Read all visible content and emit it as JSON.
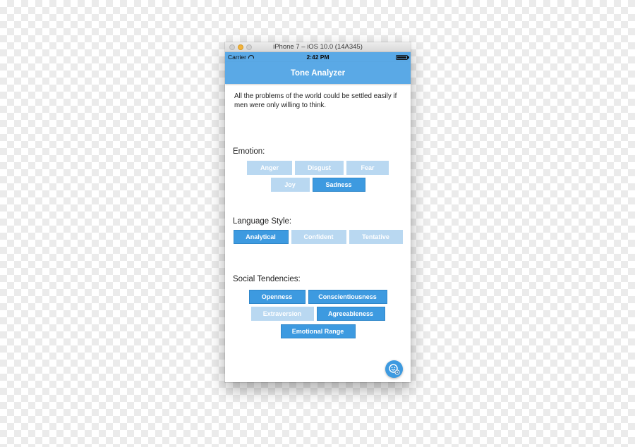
{
  "window": {
    "title": "iPhone 7 – iOS 10.0 (14A345)"
  },
  "statusbar": {
    "carrier": "Carrier",
    "time": "2:42 PM"
  },
  "navbar": {
    "title": "Tone Analyzer"
  },
  "quote": {
    "text": "All the problems of the world could be settled easily if men were only willing to think."
  },
  "emotion": {
    "label": "Emotion:",
    "row1": [
      {
        "label": "Anger",
        "selected": false
      },
      {
        "label": "Disgust",
        "selected": false
      },
      {
        "label": "Fear",
        "selected": false
      }
    ],
    "row2": [
      {
        "label": "Joy",
        "selected": false
      },
      {
        "label": "Sadness",
        "selected": true
      }
    ]
  },
  "language_style": {
    "label": "Language Style:",
    "row1": [
      {
        "label": "Analytical",
        "selected": true
      },
      {
        "label": "Confident",
        "selected": false
      },
      {
        "label": "Tentative",
        "selected": false
      }
    ]
  },
  "social": {
    "label": "Social Tendencies:",
    "row1": [
      {
        "label": "Openness",
        "selected": true
      },
      {
        "label": "Conscientiousness",
        "selected": true
      }
    ],
    "row2": [
      {
        "label": "Extraversion",
        "selected": false
      },
      {
        "label": "Agreeableness",
        "selected": true
      }
    ],
    "row3": [
      {
        "label": "Emotional Range",
        "selected": true
      }
    ]
  },
  "colors": {
    "accent": "#5aa9e6",
    "selected": "#3d9ae0",
    "unselected": "#b9d8f1"
  },
  "fab": {
    "icon": "smiley-analyze-icon"
  }
}
